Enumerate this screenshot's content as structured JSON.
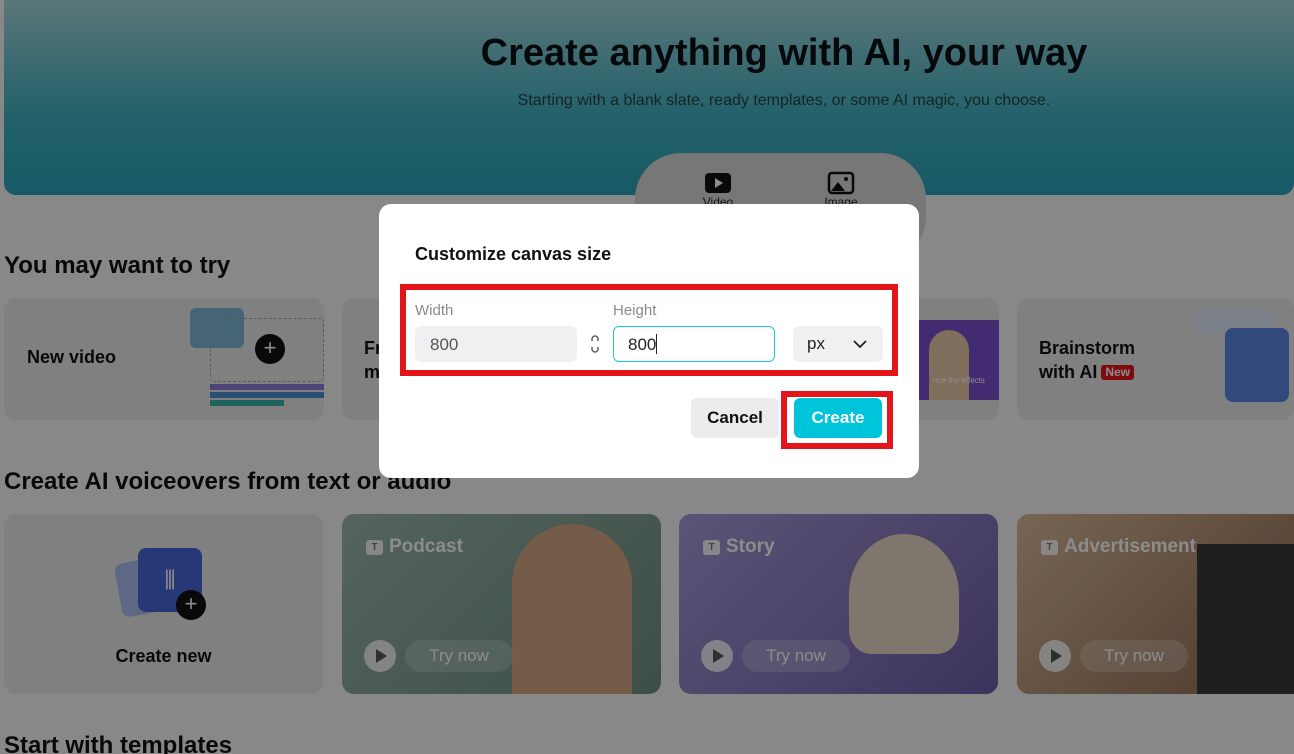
{
  "hero": {
    "title": "Create anything with AI, your way",
    "subtitle": "Starting with a blank slate, ready templates, or some AI magic, you choose.",
    "modes": [
      {
        "label": "Video",
        "icon": "video-icon"
      },
      {
        "label": "Image",
        "icon": "image-icon"
      }
    ]
  },
  "try_section": {
    "heading": "You may want to try",
    "cards": [
      {
        "label": "New video"
      },
      {
        "label": "Fr\nm"
      },
      {
        "label": "",
        "caption": "nce the effects"
      },
      {
        "label": "Brainstorm\nwith AI",
        "badge": "New"
      }
    ]
  },
  "voice_section": {
    "heading": "Create AI voiceovers from text or audio",
    "create_label": "Create new",
    "cards": [
      {
        "tag": "Podcast",
        "try": "Try now"
      },
      {
        "tag": "Story",
        "try": "Try now"
      },
      {
        "tag": "Advertisement",
        "try": "Try now"
      }
    ]
  },
  "templates_section": {
    "heading": "Start with templates"
  },
  "dialog": {
    "title": "Customize canvas size",
    "width_label": "Width",
    "width_value": "800",
    "height_label": "Height",
    "height_value": "800",
    "unit": "px",
    "cancel": "Cancel",
    "create": "Create"
  },
  "colors": {
    "accent": "#00c4da",
    "highlight": "#e3151a"
  }
}
